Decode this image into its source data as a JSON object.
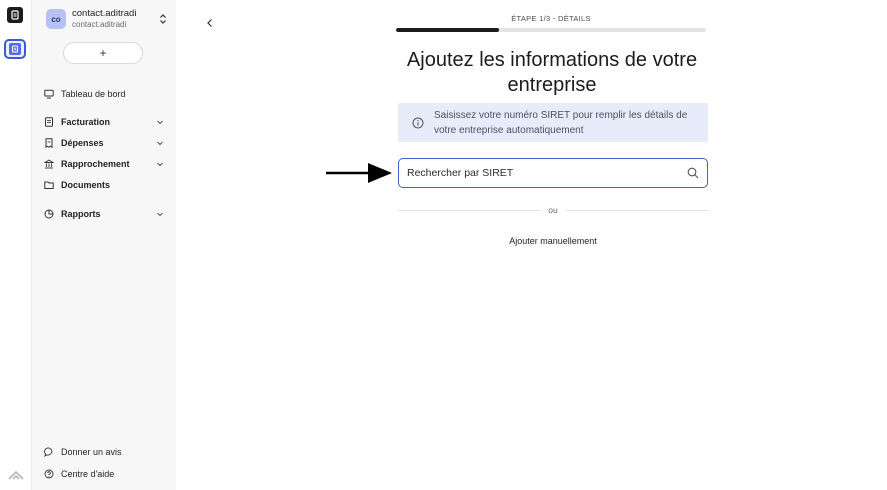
{
  "account": {
    "initials": "co",
    "name": "contact.aditradi",
    "email": "contact.aditradi"
  },
  "sidebar": {
    "add_label": "+",
    "items": [
      {
        "label": "Tableau de bord",
        "icon": "monitor-icon",
        "has_children": false
      },
      {
        "label": "Facturation",
        "icon": "invoice-icon",
        "has_children": true
      },
      {
        "label": "Dépenses",
        "icon": "receipt-icon",
        "has_children": true
      },
      {
        "label": "Rapprochement",
        "icon": "bank-icon",
        "has_children": true
      },
      {
        "label": "Documents",
        "icon": "folder-icon",
        "has_children": false
      },
      {
        "label": "Rapports",
        "icon": "pie-chart-icon",
        "has_children": true
      }
    ],
    "footer": [
      {
        "label": "Donner un avis",
        "icon": "chat-bubble-icon"
      },
      {
        "label": "Centre d'aide",
        "icon": "help-circle-icon"
      }
    ]
  },
  "main": {
    "step_label": "ÉTAPE 1/3 - DÉTAILS",
    "progress_fraction": 0.333,
    "title": "Ajoutez les informations de votre entreprise",
    "info_text": "Saisissez votre numéro SIRET pour remplir les détails de votre entreprise automatiquement",
    "search_placeholder": "Rechercher par SIRET",
    "search_value": "",
    "divider_label": "ou",
    "manual_label": "Ajouter manuellement"
  },
  "colors": {
    "accent": "#4a5ec9",
    "info_bg": "#e8ebfa",
    "sidebar_bg": "#f7f7f8",
    "progress_fill": "#1c1c1e"
  }
}
